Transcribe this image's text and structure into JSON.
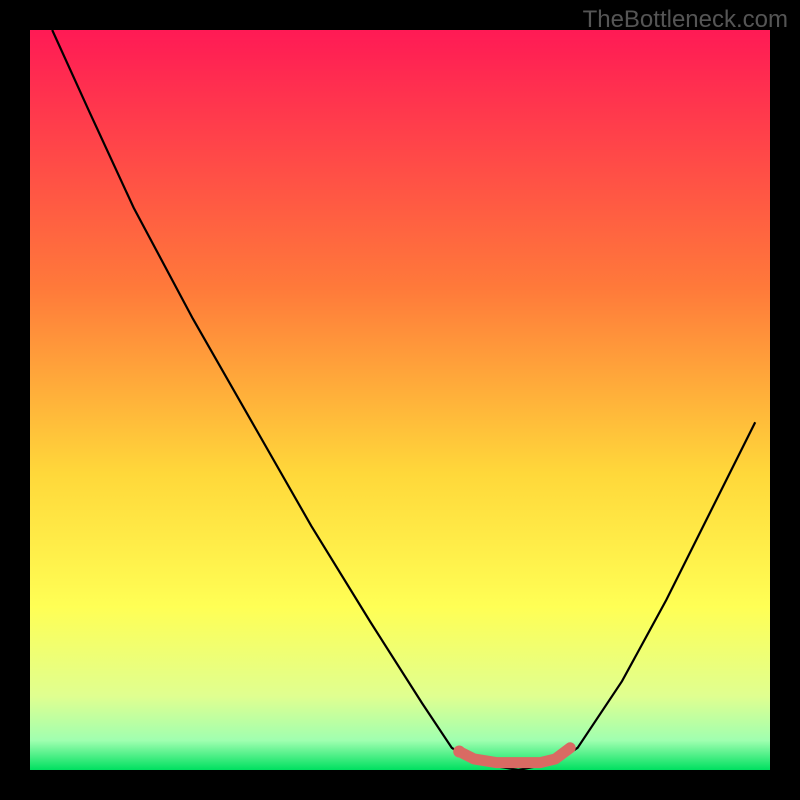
{
  "watermark": "TheBottleneck.com",
  "chart_data": {
    "type": "line",
    "title": "",
    "xlabel": "",
    "ylabel": "",
    "xlim": [
      0,
      100
    ],
    "ylim": [
      0,
      100
    ],
    "gradient_stops": [
      {
        "offset": 0,
        "color": "#ff1a55"
      },
      {
        "offset": 35,
        "color": "#ff7a3a"
      },
      {
        "offset": 60,
        "color": "#ffd83a"
      },
      {
        "offset": 78,
        "color": "#ffff55"
      },
      {
        "offset": 90,
        "color": "#e0ff90"
      },
      {
        "offset": 96,
        "color": "#a0ffb0"
      },
      {
        "offset": 100,
        "color": "#00e060"
      }
    ],
    "series": [
      {
        "name": "bottleneck-curve",
        "color": "#000000",
        "points": [
          {
            "x": 3,
            "y": 100
          },
          {
            "x": 8,
            "y": 89
          },
          {
            "x": 14,
            "y": 76
          },
          {
            "x": 22,
            "y": 61
          },
          {
            "x": 30,
            "y": 47
          },
          {
            "x": 38,
            "y": 33
          },
          {
            "x": 46,
            "y": 20
          },
          {
            "x": 53,
            "y": 9
          },
          {
            "x": 57,
            "y": 3
          },
          {
            "x": 60,
            "y": 1
          },
          {
            "x": 66,
            "y": 0
          },
          {
            "x": 71,
            "y": 1
          },
          {
            "x": 74,
            "y": 3
          },
          {
            "x": 80,
            "y": 12
          },
          {
            "x": 86,
            "y": 23
          },
          {
            "x": 92,
            "y": 35
          },
          {
            "x": 98,
            "y": 47
          }
        ]
      },
      {
        "name": "optimal-range-marker",
        "color": "#d96a63",
        "points": [
          {
            "x": 58,
            "y": 2.5
          },
          {
            "x": 60,
            "y": 1.5
          },
          {
            "x": 63,
            "y": 1
          },
          {
            "x": 66,
            "y": 1
          },
          {
            "x": 69,
            "y": 1
          },
          {
            "x": 71,
            "y": 1.5
          },
          {
            "x": 73,
            "y": 3
          }
        ]
      }
    ]
  }
}
